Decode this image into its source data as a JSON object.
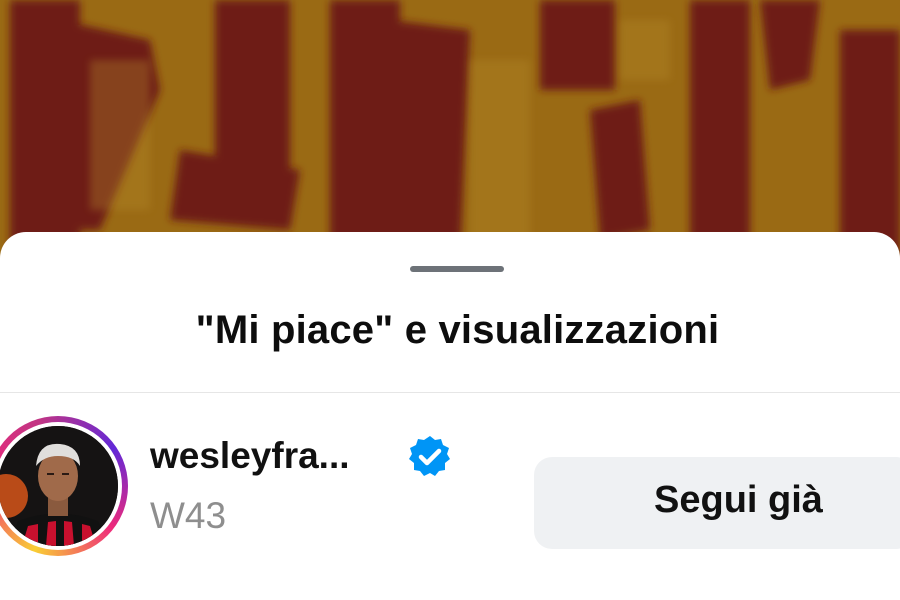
{
  "sheet": {
    "title": "\"Mi piace\" e visualizzazioni"
  },
  "viewer": {
    "username": "wesleyfra...",
    "subtitle": "W43",
    "verified": true,
    "follow_button_label": "Segui già"
  },
  "colors": {
    "background_maroon": "#6e1f12",
    "background_yellow": "#9a6a14",
    "verified_blue": "#0095f6",
    "button_bg": "#eff1f3",
    "subtitle_gray": "#8e8e8e"
  },
  "icons": {
    "verified": "verified-badge-icon",
    "grabber": "drag-handle-icon"
  }
}
